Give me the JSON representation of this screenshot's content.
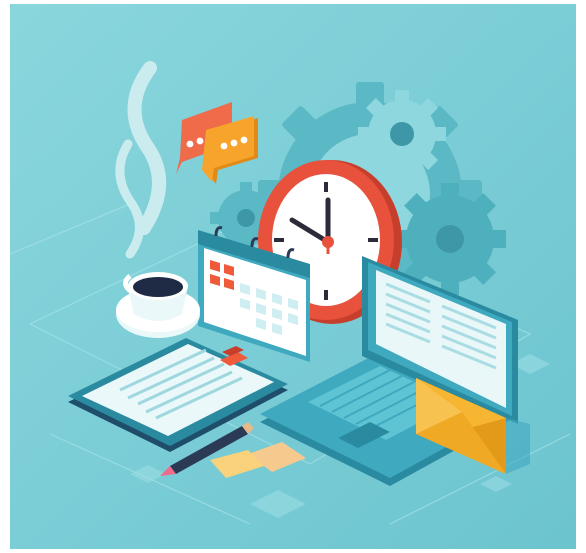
{
  "scene": {
    "subject": "isometric-office-productivity-illustration",
    "palette": {
      "background": "#7fd0d8",
      "background_light": "#9fdfe5",
      "gear": "#5bb9c6",
      "gear_light": "#8fd7df",
      "gear_dark": "#3d97a6",
      "clock_rim": "#e8523c",
      "clock_face": "#ffffff",
      "hands": "#2b2b3a",
      "calendar_mark": "#ef5a3a",
      "laptop": "#3fa9c0",
      "laptop_dark": "#2a8aa0",
      "screen": "#e9f7f8",
      "envelope": "#f6b632",
      "envelope_dark": "#e39a19",
      "chat_orange": "#f7a42c",
      "chat_coral": "#ef6b4a",
      "steam": "#d8f1f3",
      "coffee": "#1f2a44",
      "pencil": "#2b3a55",
      "pencil_tip": "#f06a8a",
      "sticky_note": "#f9d27b"
    },
    "icons": [
      "gear-icon",
      "clock-icon",
      "calendar-icon",
      "coffee-cup-icon",
      "chat-bubble-icon",
      "laptop-icon",
      "envelope-icon",
      "clipboard-icon",
      "pencil-icon",
      "sticky-note-icon"
    ]
  }
}
